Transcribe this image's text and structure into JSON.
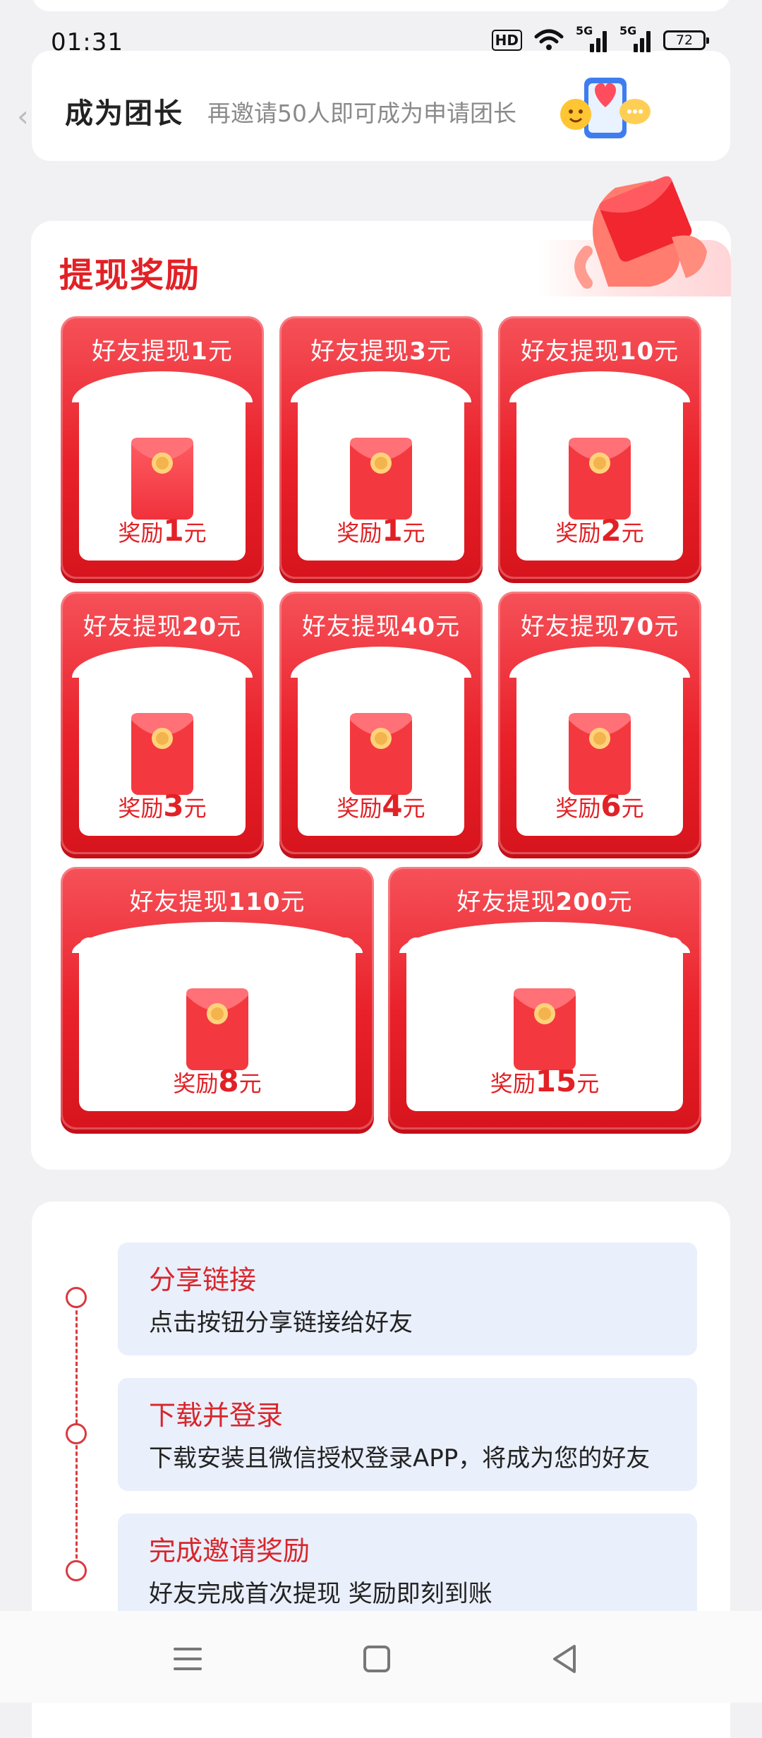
{
  "status": {
    "time": "01:31",
    "hd": "HD",
    "net1": "5G",
    "net2": "5G",
    "battery": "72"
  },
  "leader": {
    "title": "成为团长",
    "subtitle": "再邀请50人即可成为申请团长"
  },
  "rewards": {
    "title": "提现奖励",
    "tile_prefix": "好友提现",
    "tile_reward_prefix": "奖励",
    "unit": "元",
    "items": [
      {
        "withdraw": "1",
        "reward": "1"
      },
      {
        "withdraw": "3",
        "reward": "1"
      },
      {
        "withdraw": "10",
        "reward": "2"
      },
      {
        "withdraw": "20",
        "reward": "3"
      },
      {
        "withdraw": "40",
        "reward": "4"
      },
      {
        "withdraw": "70",
        "reward": "6"
      },
      {
        "withdraw": "110",
        "reward": "8"
      },
      {
        "withdraw": "200",
        "reward": "15"
      }
    ]
  },
  "steps": [
    {
      "title": "分享链接",
      "desc": "点击按钮分享链接给好友"
    },
    {
      "title": "下载并登录",
      "desc": "下载安装且微信授权登录APP，将成为您的好友"
    },
    {
      "title": "完成邀请奖励",
      "desc": "好友完成首次提现 奖励即刻到账"
    }
  ],
  "colors": {
    "accent": "#e12126",
    "tile": "#ef2a31",
    "step_bg": "#e9effb"
  },
  "icons": {
    "menu": "menu-icon",
    "home": "home-square-icon",
    "back": "back-triangle-icon"
  }
}
